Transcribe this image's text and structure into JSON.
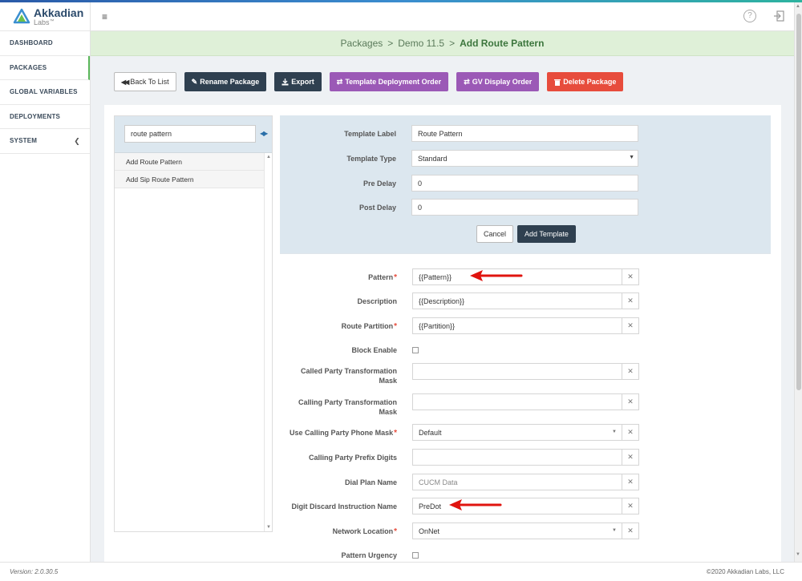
{
  "brand": {
    "name": "Akkadian",
    "sub": "Labs",
    "tm": "™"
  },
  "sidebar": {
    "items": [
      {
        "label": "DASHBOARD"
      },
      {
        "label": "PACKAGES"
      },
      {
        "label": "GLOBAL VARIABLES"
      },
      {
        "label": "DEPLOYMENTS"
      },
      {
        "label": "SYSTEM"
      }
    ]
  },
  "topbar": {
    "menu_glyph": "≡",
    "help_glyph": "?"
  },
  "breadcrumb": {
    "part1": "Packages",
    "part2": "Demo 11.5",
    "current": "Add Route Pattern",
    "sep": ">"
  },
  "actions": {
    "back": "Back To List",
    "rename": "Rename Package",
    "export": "Export",
    "tdo": "Template Deployment Order",
    "gvo": "GV Display Order",
    "delete": "Delete Package"
  },
  "search": {
    "value": "route pattern"
  },
  "list": {
    "items": [
      "Add Route Pattern",
      "Add Sip Route Pattern"
    ]
  },
  "template": {
    "label_label": "Template Label",
    "label_value": "Route Pattern",
    "type_label": "Template Type",
    "type_value": "Standard",
    "pre_label": "Pre Delay",
    "pre_value": "0",
    "post_label": "Post Delay",
    "post_value": "0",
    "cancel": "Cancel",
    "add": "Add Template"
  },
  "fields": {
    "pattern": {
      "label": "Pattern",
      "value": "{{Pattern}}"
    },
    "description": {
      "label": "Description",
      "value": "{{Description}}"
    },
    "partition": {
      "label": "Route Partition",
      "value": "{{Partition}}"
    },
    "block": {
      "label": "Block Enable"
    },
    "called_mask": {
      "label1": "Called Party Transformation",
      "label2": "Mask"
    },
    "calling_mask": {
      "label1": "Calling Party Transformation",
      "label2": "Mask"
    },
    "phone_mask": {
      "label": "Use Calling Party Phone Mask",
      "value": "Default"
    },
    "prefix": {
      "label": "Calling Party Prefix Digits"
    },
    "dial_plan": {
      "label": "Dial Plan Name",
      "value": "CUCM Data"
    },
    "digit_discard": {
      "label": "Digit Discard Instruction Name",
      "value": "PreDot"
    },
    "network": {
      "label": "Network Location",
      "value": "OnNet"
    },
    "urgency": {
      "label": "Pattern Urgency"
    }
  },
  "clear_glyph": "✕",
  "required_mark": "*",
  "footer": {
    "version": "Version: 2.0.30.5",
    "copyright": "©2020 Akkadian Labs, LLC"
  }
}
